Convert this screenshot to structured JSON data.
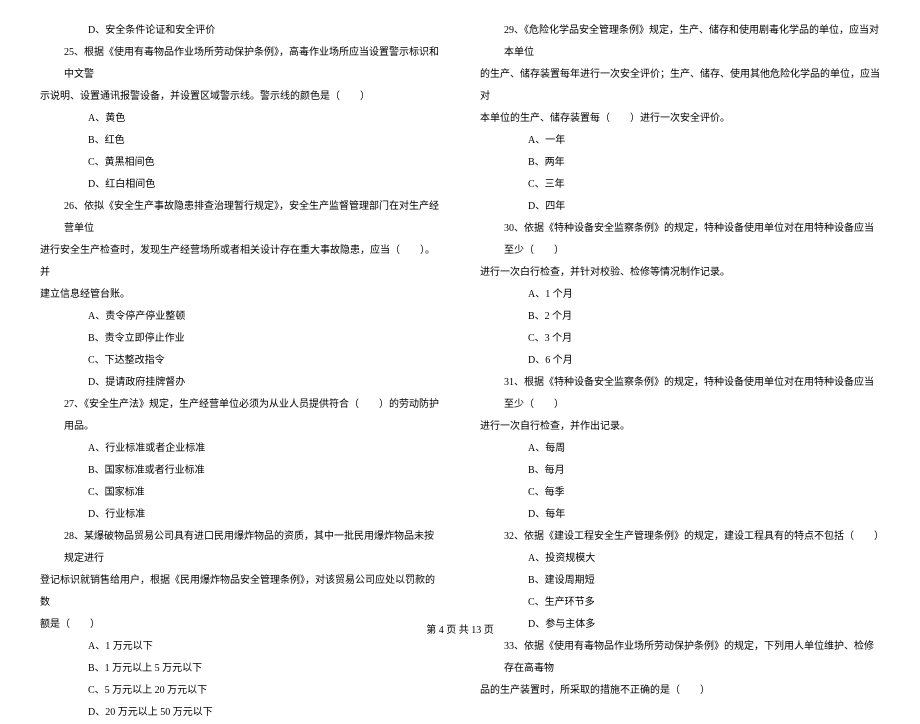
{
  "left_column": {
    "q25_opt_d_prev": "D、安全条件论证和安全评价",
    "q25": {
      "line1": "25、根据《使用有毒物品作业场所劳动保护条例》，高毒作业场所应当设置警示标识和中文警",
      "line2": "示说明、设置通讯报警设备，并设置区域警示线。警示线的颜色是（　　）",
      "options": {
        "A": "A、黄色",
        "B": "B、红色",
        "C": "C、黄黑相间色",
        "D": "D、红白相间色"
      }
    },
    "q26": {
      "line1": "26、依拟《安全生产事故隐患排查治理暂行规定》，安全生产监督管理部门在对生产经营单位",
      "line2": "进行安全生产检查时，发现生产经营场所或者相关设计存在重大事故隐患，应当（　　）。并",
      "line3": "建立信息经管台账。",
      "options": {
        "A": "A、责令停产停业整顿",
        "B": "B、责令立即停止作业",
        "C": "C、下达整改指令",
        "D": "D、提请政府挂牌督办"
      }
    },
    "q27": {
      "line1": "27、《安全生产法》规定，生产经营单位必须为从业人员提供符合（　　）的劳动防护用品。",
      "options": {
        "A": "A、行业标准或者企业标准",
        "B": "B、国家标准或者行业标准",
        "C": "C、国家标准",
        "D": "D、行业标准"
      }
    },
    "q28": {
      "line1": "28、某爆破物品贸易公司具有进口民用爆炸物品的资质，其中一批民用爆炸物品未按规定进行",
      "line2": "登记标识就销售给用户，根据《民用爆炸物品安全管理条例》，对该贸易公司应处以罚款的数",
      "line3": "额是（　　）",
      "options": {
        "A": "A、1 万元以下",
        "B": "B、1 万元以上 5 万元以下",
        "C": "C、5 万元以上 20 万元以下",
        "D": "D、20 万元以上 50 万元以下"
      }
    }
  },
  "right_column": {
    "q29": {
      "line1": "29、《危险化学品安全管理条例》规定，生产、储存和使用剧毒化学品的单位，应当对本单位",
      "line2": "的生产、储存装置每年进行一次安全评价；生产、储存、使用其他危险化学品的单位，应当对",
      "line3": "本单位的生产、储存装置每（　　）进行一次安全评价。",
      "options": {
        "A": "A、一年",
        "B": "B、两年",
        "C": "C、三年",
        "D": "D、四年"
      }
    },
    "q30": {
      "line1": "30、依据《特种设备安全监察条例》的规定，特种设备使用单位对在用特种设备应当至少（　　）",
      "line2": "进行一次白行检查，并针对校验、检修等情况制作记录。",
      "options": {
        "A": "A、1 个月",
        "B": "B、2 个月",
        "C": "C、3 个月",
        "D": "D、6 个月"
      }
    },
    "q31": {
      "line1": "31、根据《特种设备安全监察条例》的规定，特种设备使用单位对在用特种设备应当至少（　　）",
      "line2": "进行一次自行检查，并作出记录。",
      "options": {
        "A": "A、每周",
        "B": "B、每月",
        "C": "C、每季",
        "D": "D、每年"
      }
    },
    "q32": {
      "line1": "32、依据《建设工程安全生产管理条例》的规定，建设工程具有的特点不包括（　　）",
      "options": {
        "A": "A、投资规模大",
        "B": "B、建设周期短",
        "C": "C、生产环节多",
        "D": "D、参与主体多"
      }
    },
    "q33": {
      "line1": "33、依据《使用有毒物品作业场所劳动保护条例》的规定，下列用人单位维护、检修存在高毒物",
      "line2": "品的生产装置时，所采取的措施不正确的是（　　）"
    }
  },
  "footer": "第 4 页 共 13 页"
}
